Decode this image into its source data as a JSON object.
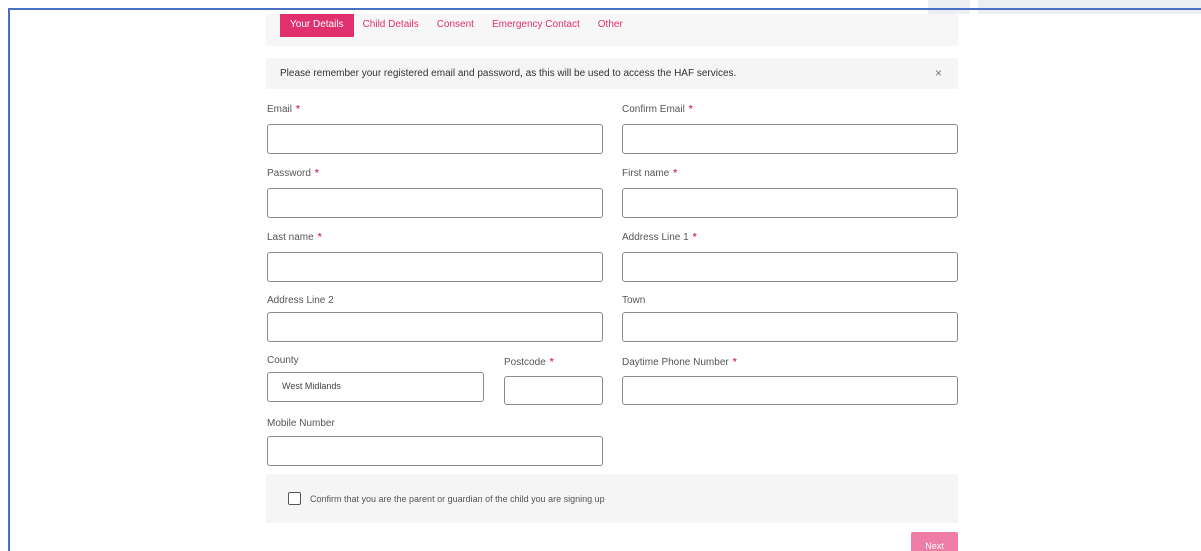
{
  "tabs": [
    {
      "label": "Your Details",
      "active": true
    },
    {
      "label": "Child Details",
      "active": false
    },
    {
      "label": "Consent",
      "active": false
    },
    {
      "label": "Emergency Contact",
      "active": false
    },
    {
      "label": "Other",
      "active": false
    }
  ],
  "notice": {
    "text": "Please remember your registered email and password, as this will be used to access the HAF services.",
    "close_glyph": "×"
  },
  "fields": {
    "email": {
      "label": "Email",
      "required_mark": "*",
      "value": ""
    },
    "confirm_email": {
      "label": "Confirm Email",
      "required_mark": "*",
      "value": ""
    },
    "password": {
      "label": "Password",
      "required_mark": "*",
      "value": ""
    },
    "first_name": {
      "label": "First name",
      "required_mark": "*",
      "value": ""
    },
    "last_name": {
      "label": "Last name",
      "required_mark": "*",
      "value": ""
    },
    "address_line_1": {
      "label": "Address Line 1",
      "required_mark": "*",
      "value": ""
    },
    "address_line_2": {
      "label": "Address Line 2",
      "value": ""
    },
    "town": {
      "label": "Town",
      "value": ""
    },
    "county": {
      "label": "County",
      "value": "West Midlands"
    },
    "postcode": {
      "label": "Postcode",
      "required_mark": "*",
      "value": ""
    },
    "daytime_phone": {
      "label": "Daytime Phone Number",
      "required_mark": "*",
      "value": ""
    },
    "mobile": {
      "label": "Mobile Number",
      "value": ""
    }
  },
  "confirm": {
    "text": "Confirm that you are the parent or guardian of the child you are signing up",
    "checked": false
  },
  "buttons": {
    "next": "Next"
  },
  "colors": {
    "accent": "#e0306e",
    "next_button": "#ee7da5",
    "frame_border": "#4a6fc7"
  }
}
